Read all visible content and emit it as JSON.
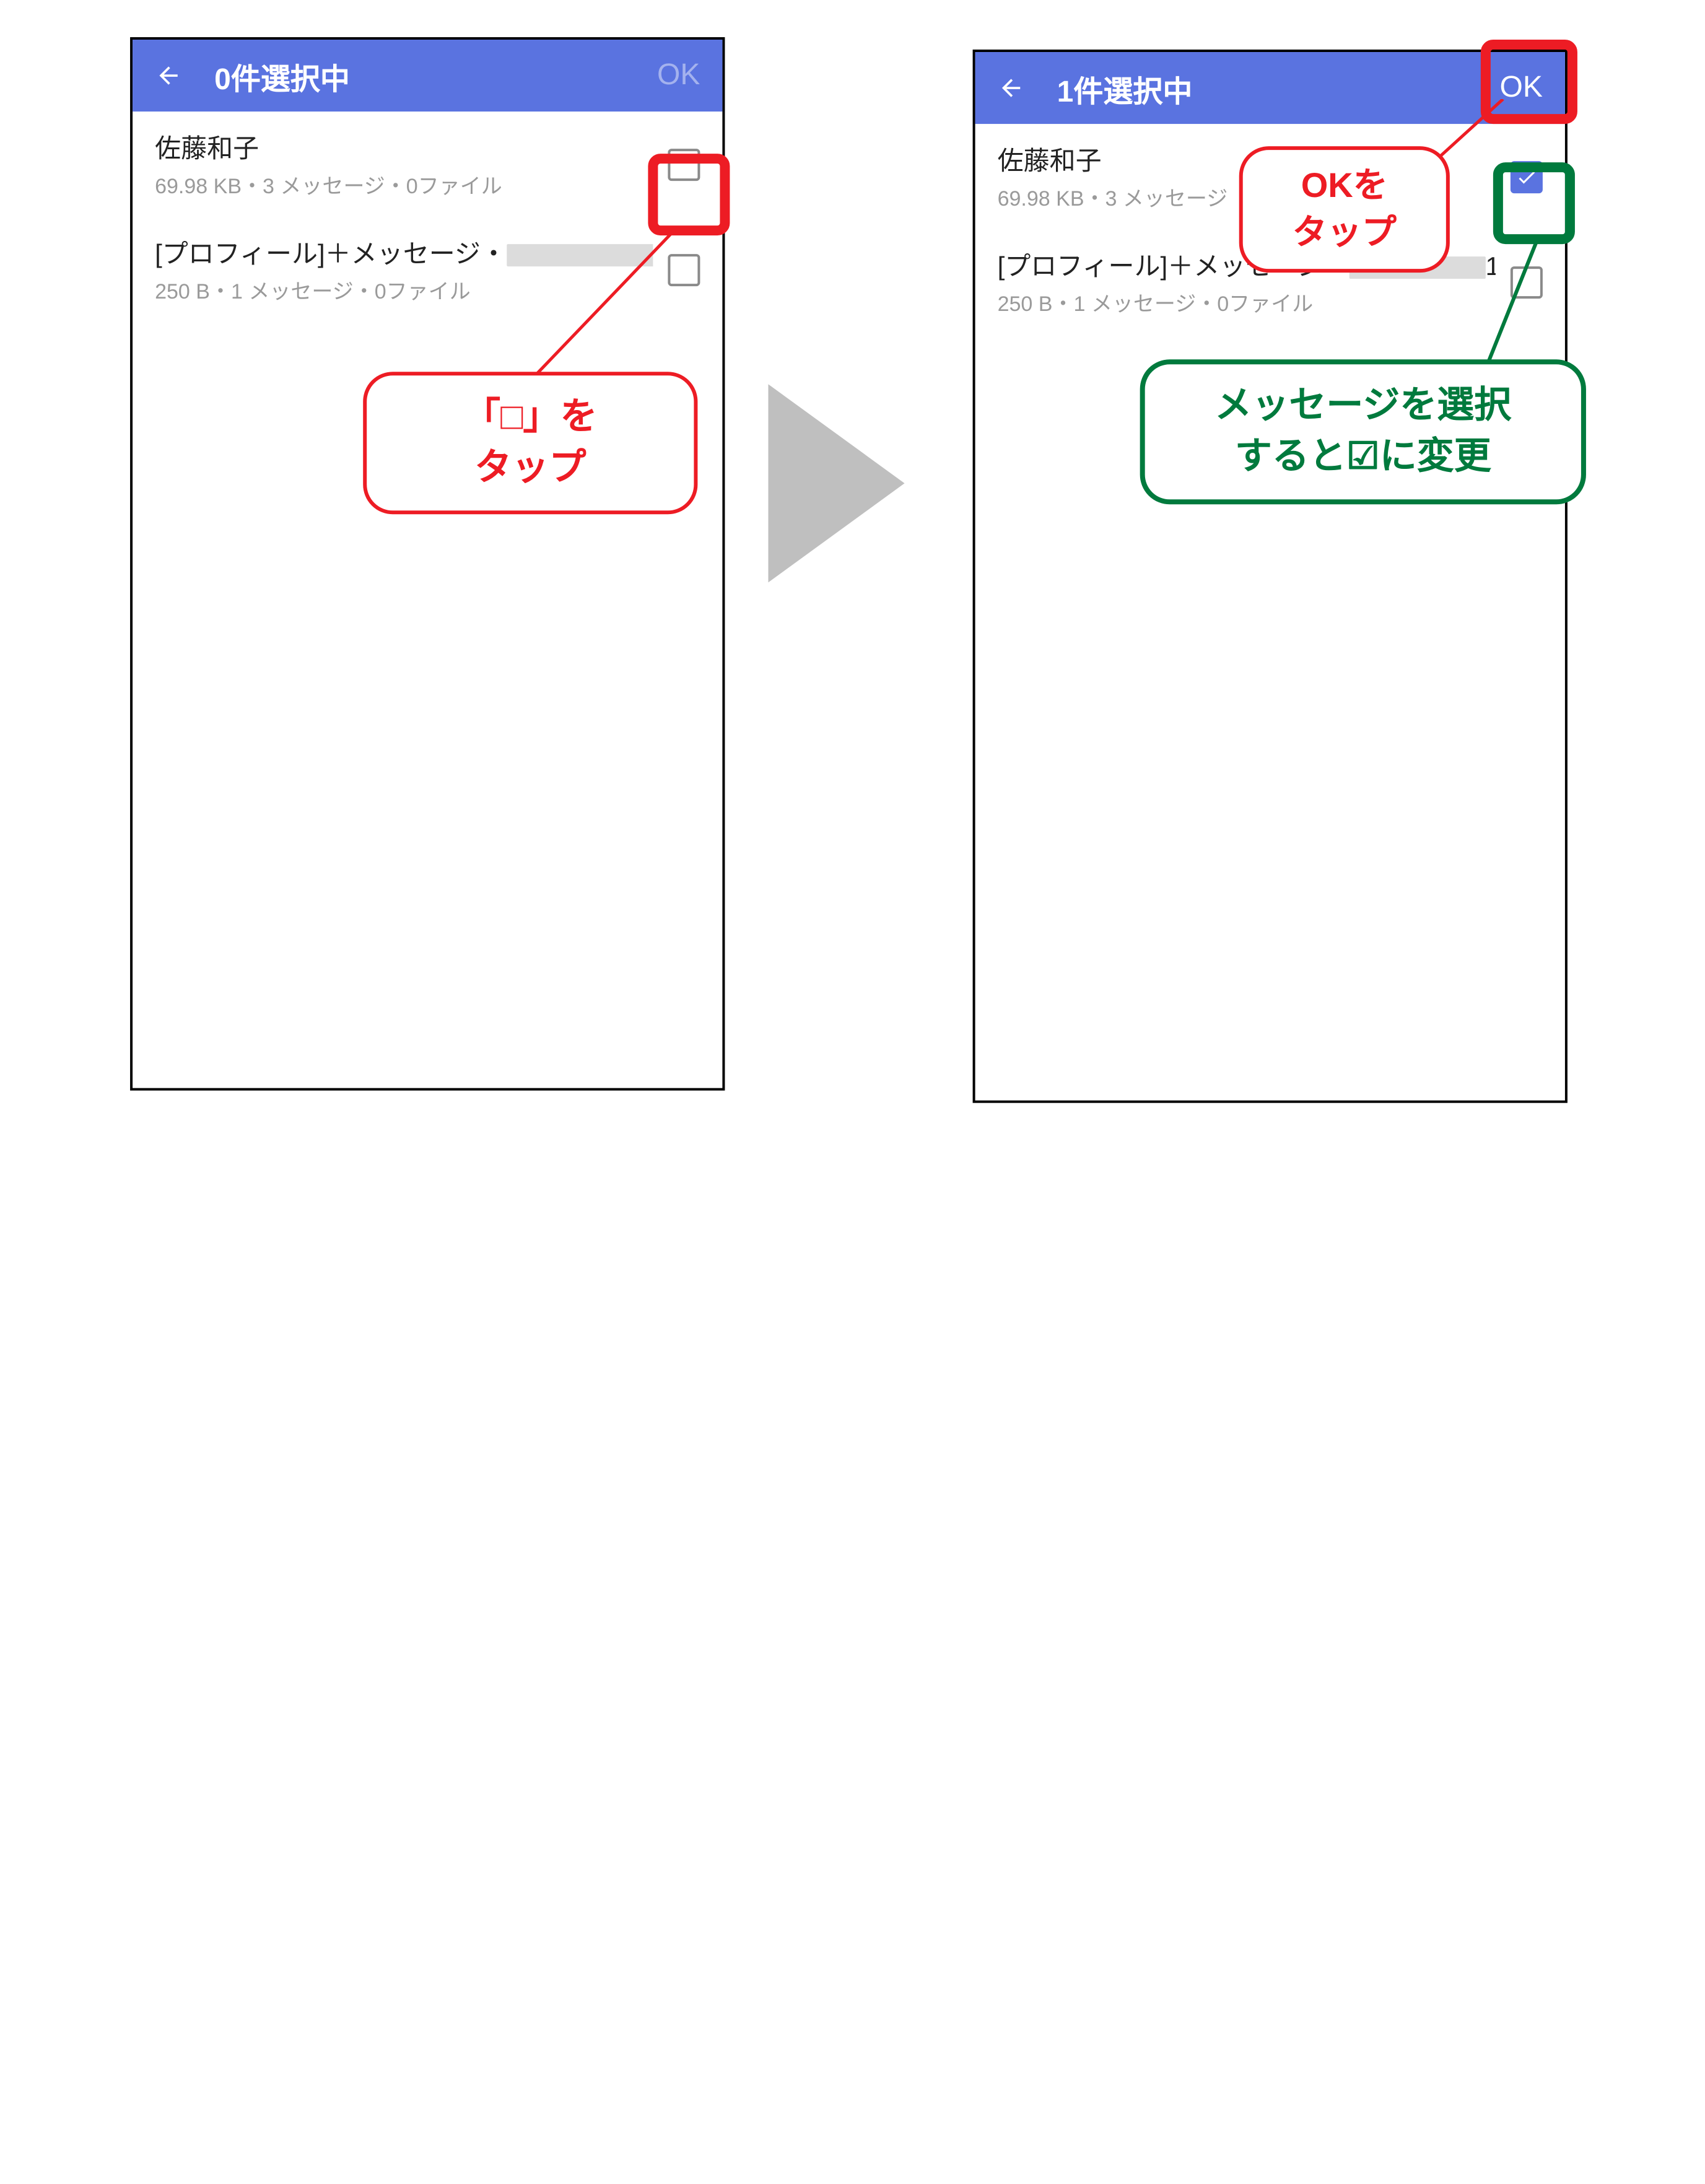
{
  "left": {
    "appbar": {
      "title": "0件選択中",
      "ok": "OK"
    },
    "rows": [
      {
        "title": "佐藤和子",
        "sub": "69.98 KB・3 メッセージ・0ファイル"
      },
      {
        "title_prefix": "[プロフィール]＋メッセージ・",
        "sub": "250 B・1 メッセージ・0ファイル"
      }
    ],
    "callout": {
      "l1": "「□」を",
      "l2": "タップ"
    }
  },
  "right": {
    "appbar": {
      "title": "1件選択中",
      "ok": "OK"
    },
    "rows": [
      {
        "title": "佐藤和子",
        "sub_prefix": "69.98 KB・3 メッセージ"
      },
      {
        "title_prefix": "[プロフィール]＋メッセージ・",
        "title_suffix": "1",
        "sub": "250 B・1 メッセージ・0ファイル"
      }
    ],
    "callout_ok": {
      "l1": "OKを",
      "l2": "タップ"
    },
    "callout_check": {
      "l1": "メッセージを選択",
      "l2": "すると☑に変更"
    }
  }
}
